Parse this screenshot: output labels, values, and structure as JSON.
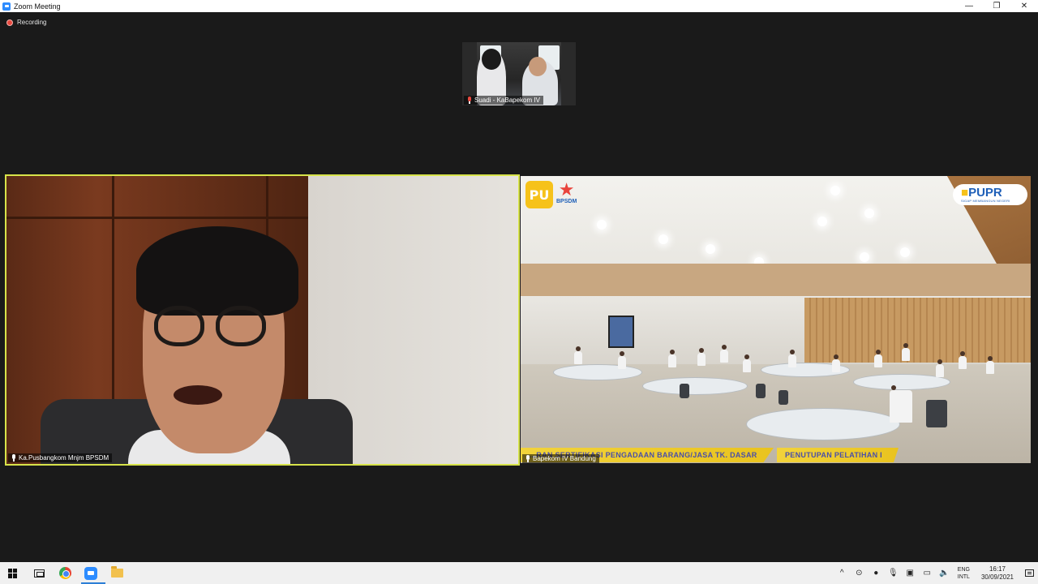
{
  "window": {
    "title": "Zoom Meeting",
    "minimize": "—",
    "restore": "❐",
    "close": "✕"
  },
  "meeting": {
    "recording_label": "Recording",
    "thumbnail_participant": "Suadi - KaBapekom IV",
    "left_tile_participant": "Ka.Pusbangkom Mnjm BPSDM",
    "right_tile_participant": "Bapekom IV Bandung",
    "active_speaker_border_color": "#d7e34a"
  },
  "shared_video": {
    "logo_left_text": "BPSDM",
    "logo_right_text": "PUPR",
    "logo_right_subtext": "SIGAP MEMBANGUN NEGERI",
    "ticker_left": "…RAN SERTIFIKASI PENGADAAN BARANG/JASA TK. DASAR",
    "ticker_right": "PENUTUPAN PELATIHAN I"
  },
  "taskbar": {
    "apps": [
      "start-icon",
      "task-view-icon",
      "chrome-icon",
      "zoom-icon",
      "file-explorer-icon"
    ],
    "tray_chevron": "^",
    "lang_top": "ENG",
    "lang_bottom": "INTL",
    "time": "16:17",
    "date": "30/09/2021"
  }
}
